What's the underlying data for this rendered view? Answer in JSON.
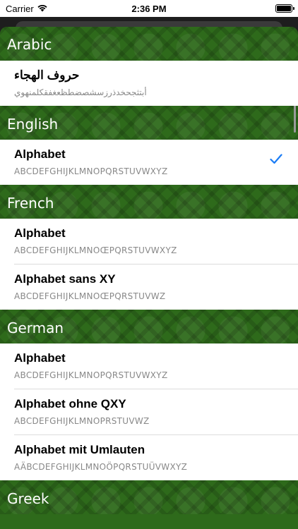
{
  "status_bar": {
    "carrier": "Carrier",
    "time": "2:36 PM"
  },
  "sections": [
    {
      "header": "Arabic",
      "items": [
        {
          "title": "حروف الهجاء",
          "subtitle": "أبتثجحخدذرزسشصضطظعغفقكلمنهوي",
          "checked": false
        }
      ]
    },
    {
      "header": "English",
      "items": [
        {
          "title": "Alphabet",
          "subtitle": "ABCDEFGHIJKLMNOPQRSTUVWXYZ",
          "checked": true
        }
      ]
    },
    {
      "header": "French",
      "items": [
        {
          "title": "Alphabet",
          "subtitle": "ABCDEFGHIJKLMNOŒPQRSTUVWXYZ",
          "checked": false
        },
        {
          "title": "Alphabet sans XY",
          "subtitle": "ABCDEFGHIJKLMNOŒPQRSTUVWZ",
          "checked": false
        }
      ]
    },
    {
      "header": "German",
      "items": [
        {
          "title": "Alphabet",
          "subtitle": "ABCDEFGHIJKLMNOPQRSTUVWXYZ",
          "checked": false
        },
        {
          "title": "Alphabet ohne QXY",
          "subtitle": "ABCDEFGHIJKLMNOPRSTUVWZ",
          "checked": false
        },
        {
          "title": "Alphabet mit Umlauten",
          "subtitle": "AÄBCDEFGHIJKLMNOÖPQRSTUÜVWXYZ",
          "checked": false
        }
      ]
    },
    {
      "header": "Greek",
      "items": []
    }
  ],
  "colors": {
    "header_green": "#2e6a1b",
    "check_blue": "#1a7cf5"
  },
  "icons": {
    "checkmark": "checkmark-icon",
    "wifi": "wifi-icon",
    "battery": "battery-icon"
  }
}
